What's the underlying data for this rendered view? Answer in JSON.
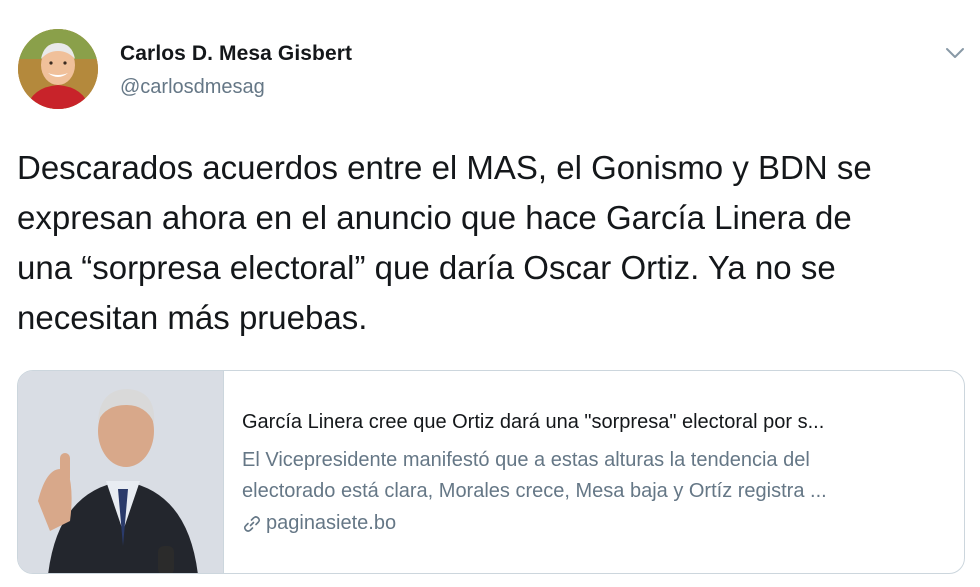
{
  "user": {
    "name": "Carlos D. Mesa Gisbert",
    "handle": "@carlosdmesag"
  },
  "tweet": {
    "text": "Descarados acuerdos entre el MAS, el Gonismo y BDN se\nexpresan ahora en el anuncio que hace García Linera de\nuna “sorpresa electoral” que daría Oscar Ortiz. Ya no se\nnecesitan más pruebas."
  },
  "card": {
    "title": "García Linera cree que Ortiz dará una \"sorpresa\" electoral por s...",
    "description": "El Vicepresidente manifestó que a estas alturas la tendencia del\nelectorado está clara, Morales crece, Mesa baja y Ortíz registra ...",
    "domain": "paginasiete.bo",
    "domain_icon": "link-icon"
  },
  "icons": {
    "menu": "chevron-down-icon"
  },
  "colors": {
    "text": "#14171a",
    "secondary": "#657786",
    "border": "#ccd6dd"
  }
}
